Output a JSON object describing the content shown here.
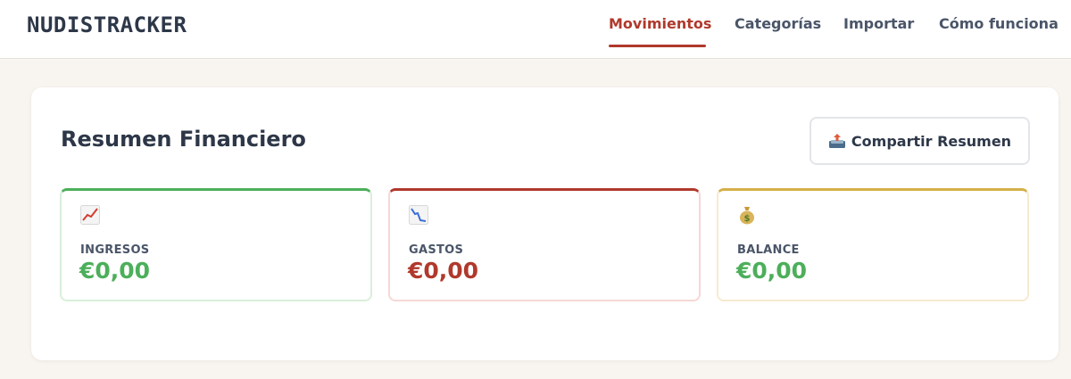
{
  "header": {
    "logo": "NUDISTRACKER",
    "nav": [
      {
        "label": "Movimientos",
        "active": true
      },
      {
        "label": "Categorías",
        "active": false
      },
      {
        "label": "Importar",
        "active": false
      },
      {
        "label": "Cómo funciona",
        "active": false
      }
    ],
    "accent_color": "#b0392c"
  },
  "summary": {
    "title": "Resumen Financiero",
    "share_button": {
      "label": "Compartir Resumen",
      "icon": "inbox-tray-icon"
    },
    "stats": [
      {
        "label": "INGRESOS",
        "value": "€0,00",
        "icon": "chart-increasing-icon",
        "color": "#4caf5a"
      },
      {
        "label": "GASTOS",
        "value": "€0,00",
        "icon": "chart-decreasing-icon",
        "color": "#b0392c"
      },
      {
        "label": "BALANCE",
        "value": "€0,00",
        "icon": "money-bag-icon",
        "color": "#4caf5a"
      }
    ]
  }
}
